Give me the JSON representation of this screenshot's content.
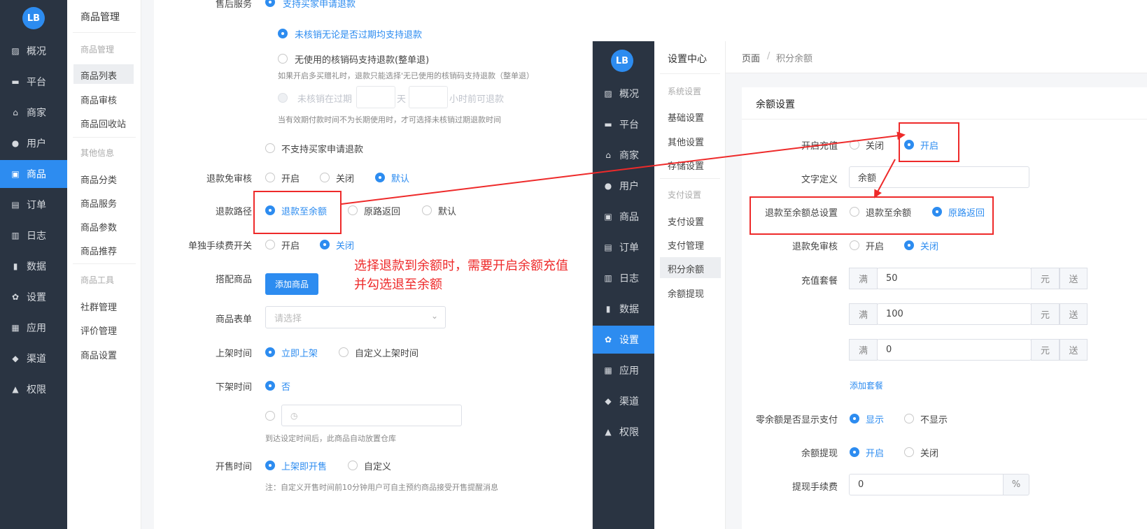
{
  "left": {
    "logo_text": "LB",
    "nav": [
      {
        "label": "概况",
        "icon": "overview-icon",
        "glyph": "▨"
      },
      {
        "label": "平台",
        "icon": "monitor-icon",
        "glyph": "▬"
      },
      {
        "label": "商家",
        "icon": "store-icon",
        "glyph": "⌂"
      },
      {
        "label": "用户",
        "icon": "user-icon",
        "glyph": "●"
      },
      {
        "label": "商品",
        "icon": "product-icon",
        "glyph": "▣"
      },
      {
        "label": "订单",
        "icon": "order-icon",
        "glyph": "▤"
      },
      {
        "label": "日志",
        "icon": "log-icon",
        "glyph": "▥"
      },
      {
        "label": "数据",
        "icon": "chart-icon",
        "glyph": "▮"
      },
      {
        "label": "设置",
        "icon": "gear-icon",
        "glyph": "✿"
      },
      {
        "label": "应用",
        "icon": "apps-icon",
        "glyph": "▦"
      },
      {
        "label": "渠道",
        "icon": "cube-icon",
        "glyph": "◆"
      },
      {
        "label": "权限",
        "icon": "lock-icon",
        "glyph": "▲"
      }
    ],
    "active_nav": "商品",
    "sub_title": "商品管理",
    "sub_groups": [
      {
        "title": "商品管理",
        "items": [
          "商品列表",
          "商品审核",
          "商品回收站"
        ]
      },
      {
        "title": "其他信息",
        "items": [
          "商品分类",
          "商品服务",
          "商品参数",
          "商品推荐"
        ]
      },
      {
        "title": "商品工具",
        "items": [
          "社群管理",
          "评价管理",
          "商品设置"
        ]
      }
    ],
    "form": {
      "after_sale_label": "售后服务",
      "after_sale_option": "支持买家申请退款",
      "opt_unverified": "未核销无论是否过期均支持退款",
      "opt_unused": "无使用的核销码支持退款(整单退)",
      "hint_unused": "如果开启多买赠礼时，退款只能选择'无已使用的核销码支持退款（整单退）",
      "opt_expired_pre": "未核销在过期",
      "opt_expired_day": "天",
      "opt_expired_suf": "小时前可退款",
      "hint_expired": "当有效期付款时间不为长期使用时，才可选择未核销过期退款时间",
      "opt_no_refund": "不支持买家申请退款",
      "refund_review_label": "退款免审核",
      "refund_review_opts": [
        "开启",
        "关闭",
        "默认"
      ],
      "refund_path_label": "退款路径",
      "refund_path_opts": [
        "退款至余额",
        "原路返回",
        "默认"
      ],
      "fee_switch_label": "单独手续费开关",
      "fee_switch_opts": [
        "开启",
        "关闭"
      ],
      "bundle_label": "搭配商品",
      "bundle_button": "添加商品",
      "form_label": "商品表单",
      "form_placeholder": "请选择",
      "listing_label": "上架时间",
      "listing_opts": [
        "立即上架",
        "自定义上架时间"
      ],
      "delist_label": "下架时间",
      "delist_opt": "否",
      "delist_hint": "到达设定时间后，此商品自动放置仓库",
      "sale_label": "开售时间",
      "sale_opts": [
        "上架即开售",
        "自定义"
      ],
      "sale_hint": "注：自定义开售时间前10分钟用户可自主预约商品接受开售提醒消息"
    },
    "annotation": [
      "选择退款到余额时，需要开启余额充值",
      "并勾选退至余额"
    ]
  },
  "right": {
    "logo_text": "LB",
    "nav": [
      {
        "label": "概况",
        "icon": "overview-icon",
        "glyph": "▨"
      },
      {
        "label": "平台",
        "icon": "monitor-icon",
        "glyph": "▬"
      },
      {
        "label": "商家",
        "icon": "store-icon",
        "glyph": "⌂"
      },
      {
        "label": "用户",
        "icon": "user-icon",
        "glyph": "●"
      },
      {
        "label": "商品",
        "icon": "product-icon",
        "glyph": "▣"
      },
      {
        "label": "订单",
        "icon": "order-icon",
        "glyph": "▤"
      },
      {
        "label": "日志",
        "icon": "log-icon",
        "glyph": "▥"
      },
      {
        "label": "数据",
        "icon": "chart-icon",
        "glyph": "▮"
      },
      {
        "label": "设置",
        "icon": "gear-icon",
        "glyph": "✿"
      },
      {
        "label": "应用",
        "icon": "apps-icon",
        "glyph": "▦"
      },
      {
        "label": "渠道",
        "icon": "cube-icon",
        "glyph": "◆"
      },
      {
        "label": "权限",
        "icon": "lock-icon",
        "glyph": "▲"
      }
    ],
    "active_nav": "设置",
    "sub_title": "设置中心",
    "sub_groups": [
      {
        "title": "系统设置",
        "items": [
          "基础设置",
          "其他设置",
          "存储设置"
        ]
      },
      {
        "title": "支付设置",
        "items": [
          "支付设置",
          "支付管理",
          "积分余额",
          "余额提现"
        ]
      }
    ],
    "breadcrumb": [
      "页面",
      "/",
      "积分余额"
    ],
    "card_title": "余额设置",
    "recharge_label": "开启充值",
    "recharge_opts": [
      "关闭",
      "开启"
    ],
    "text_label": "文字定义",
    "text_value": "余额",
    "refund_total_label": "退款至余额总设置",
    "refund_total_opts": [
      "退款至余额",
      "原路返回"
    ],
    "refund_review_label": "退款免审核",
    "refund_review_opts": [
      "开启",
      "关闭"
    ],
    "package_label": "充值套餐",
    "packages": [
      {
        "prefix": "满",
        "value": "50",
        "unit": "元",
        "suffix": "送"
      },
      {
        "prefix": "满",
        "value": "100",
        "unit": "元",
        "suffix": "送"
      },
      {
        "prefix": "满",
        "value": "0",
        "unit": "元",
        "suffix": "送"
      }
    ],
    "add_package": "添加套餐",
    "zero_label": "零余额是否显示支付",
    "zero_opts": [
      "显示",
      "不显示"
    ],
    "withdraw_label": "余额提现",
    "withdraw_opts": [
      "开启",
      "关闭"
    ],
    "fee_label": "提现手续费",
    "fee_value": "0",
    "fee_unit": "%"
  },
  "colors": {
    "accent": "#2d8cf0",
    "sidebar": "#2a3442",
    "annotation": "#ee2a2a"
  }
}
